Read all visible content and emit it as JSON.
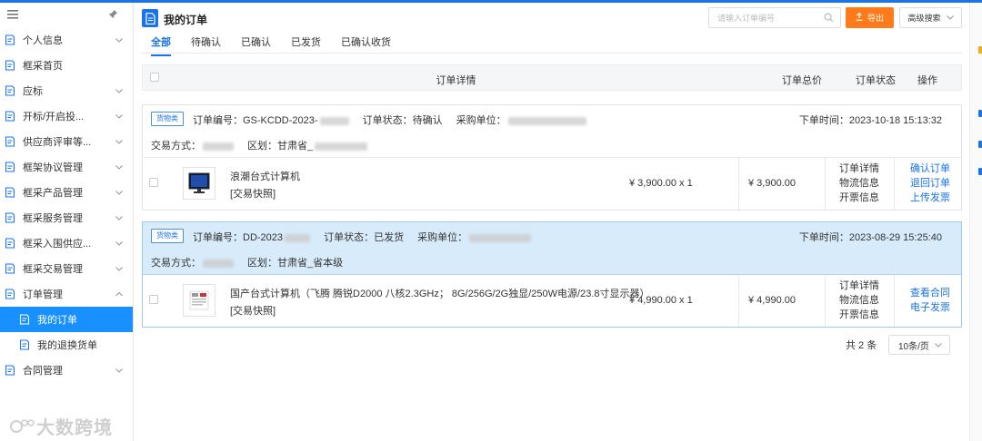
{
  "colors": {
    "accent": "#1a73e8",
    "export": "#ff7a1a",
    "active_sidebar": "#1890ff",
    "highlight_row": "#d8ebfa"
  },
  "sidebar": {
    "menu_icon": "hamburger-icon",
    "pin_icon": "pin-icon",
    "items": [
      {
        "label": "个人信息",
        "chevron": "chevron-down-icon"
      },
      {
        "label": "框采首页"
      },
      {
        "label": "应标",
        "chevron": "chevron-down-icon"
      },
      {
        "label": "开标/开启投...",
        "chevron": "chevron-down-icon"
      },
      {
        "label": "供应商评审等...",
        "chevron": "chevron-down-icon"
      },
      {
        "label": "框架协议管理",
        "chevron": "chevron-down-icon"
      },
      {
        "label": "框采产品管理",
        "chevron": "chevron-down-icon"
      },
      {
        "label": "框采服务管理",
        "chevron": "chevron-down-icon"
      },
      {
        "label": "框采入围供应...",
        "chevron": "chevron-down-icon"
      },
      {
        "label": "框采交易管理",
        "chevron": "chevron-down-icon"
      },
      {
        "label": "订单管理",
        "chevron": "chevron-up-icon"
      },
      {
        "label": "我的订单",
        "active": true
      },
      {
        "label": "我的退换货单"
      },
      {
        "label": "合同管理",
        "chevron": "chevron-down-icon"
      }
    ],
    "watermark": "大数跨境"
  },
  "header": {
    "title": "我的订单",
    "search_placeholder": "请输入订单编号",
    "export_label": "导出",
    "advanced_label": "高级搜索"
  },
  "tabs": [
    "全部",
    "待确认",
    "已确认",
    "已发货",
    "已确认收货"
  ],
  "table": {
    "columns": [
      "订单详情",
      "订单总价",
      "订单状态",
      "操作"
    ]
  },
  "orders": [
    {
      "badge": "货物类",
      "order_no": "订单编号：GS-KCDD-2023-",
      "status_text": "订单状态：待确认",
      "buyer": "采购单位：",
      "time": "下单时间：2023-10-18 15:13:32",
      "trade": "交易方式：",
      "region": "区划：甘肃省_",
      "product": "浪潮台式计算机",
      "snapshot": "[交易快照]",
      "unit_price": "¥ 3,900.00 x 1",
      "total": "¥ 3,900.00",
      "status_lines": [
        "订单详情",
        "物流信息",
        "开票信息"
      ],
      "ops": [
        "确认订单",
        "退回订单",
        "上传发票"
      ]
    },
    {
      "badge": "货物类",
      "order_no": "订单编号：DD-2023",
      "status_text": "订单状态：已发货",
      "buyer": "采购单位：",
      "time": "下单时间：2023-08-29 15:25:40",
      "trade": "交易方式：",
      "region": "区划：甘肃省_省本级",
      "product": "国产台式计算机（飞腾 腾锐D2000 八核2.3GHz； 8G/256G/2G独显/250W电源/23.8寸显示器）",
      "snapshot": "[交易快照]",
      "unit_price": "¥ 4,990.00 x 1",
      "total": "¥ 4,990.00",
      "status_lines": [
        "订单详情",
        "物流信息",
        "开票信息"
      ],
      "ops": [
        "查看合同",
        "电子发票"
      ]
    }
  ],
  "pager": {
    "total": "共 2 条",
    "page_size": "10条/页"
  }
}
